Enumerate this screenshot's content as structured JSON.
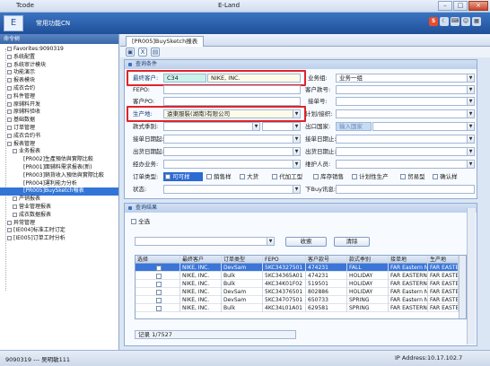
{
  "window": {
    "tcode_label": "Tcode",
    "app_title": "E-Land"
  },
  "header": {
    "app_name": "常用功能CN",
    "logo_glyph": "S"
  },
  "sidebar": {
    "title": "命令树",
    "nodes": [
      {
        "label": "Favorites:9090319",
        "level": 1
      },
      {
        "label": "系统配置",
        "level": 1
      },
      {
        "label": "系统审计模块",
        "level": 1
      },
      {
        "label": "功能演示",
        "level": 1
      },
      {
        "label": "报表模块",
        "level": 1
      },
      {
        "label": "成衣合约",
        "level": 1
      },
      {
        "label": "料件管理",
        "level": 1
      },
      {
        "label": "原辅料开发",
        "level": 1
      },
      {
        "label": "原辅料验收",
        "level": 1
      },
      {
        "label": "基础数据",
        "level": 1
      },
      {
        "label": "订单管理",
        "level": 1
      },
      {
        "label": "成衣合约书",
        "level": 1
      },
      {
        "label": "报表管理",
        "level": 1
      },
      {
        "label": "业务报表",
        "level": 2
      },
      {
        "label": "[PR002]生產預估與實際比較",
        "level": 3
      },
      {
        "label": "[PR001]面辅料需求报表(新)",
        "level": 3
      },
      {
        "label": "[PR003]銷貨收入預估與實際比較",
        "level": 3
      },
      {
        "label": "[PR004]運利能力分析",
        "level": 3
      },
      {
        "label": "[PR005]BuySketch報表",
        "level": 3,
        "selected": true
      },
      {
        "label": "产销报表",
        "level": 2
      },
      {
        "label": "营业管理报表",
        "level": 2
      },
      {
        "label": "成衣数据报表",
        "level": 2
      },
      {
        "label": "异常管理",
        "level": 1
      },
      {
        "label": "[IE004]标准工时订定",
        "level": 1
      },
      {
        "label": "[IE005]订单工时分析",
        "level": 1
      }
    ]
  },
  "tab": {
    "label": "[PR005]BuySketch报表"
  },
  "query_panel": {
    "title": "查询条件",
    "final_customer_label": "最终客户:",
    "final_customer_code": "C34",
    "final_customer_name": "NIKE, INC.",
    "business_group_label": "业务组:",
    "business_group_value": "业务一组",
    "fepo_label": "FEPO:",
    "customer_style_label": "客户款号:",
    "customer_po_label": "客户PO:",
    "order_no_label": "接单号:",
    "production_site_label": "生产地:",
    "production_site_value": "遠東服裝(湖南)有限公司",
    "plan_line_label": "计划/接织:",
    "season_label": "款式季别:",
    "export_country_label": "出口国家:",
    "export_country_placeholder": "输入国家",
    "order_date_label": "接单日期起:",
    "order_date_to_label": "接单日期止:",
    "ship_date_label": "出货日期起:",
    "ship_date_to_label": "出货日期止:",
    "dealer_label": "经办业务:",
    "maintainer_label": "维护人员:",
    "order_type_label": "订单类型:",
    "order_types": [
      "可可样",
      "銷售样",
      "大货",
      "代加工型",
      "库存销售",
      "计划性生产",
      "贸易型",
      "确认样"
    ],
    "status_label": "状态:",
    "buy_status_label": "下Buy讯息:"
  },
  "result_panel": {
    "title": "查询结果",
    "select_all_label": "全选",
    "query_button": "收索",
    "clear_button": "清除",
    "columns": [
      "选择",
      "最终客户",
      "订单类型",
      "FEPO",
      "客户款号",
      "款式季别",
      "接单地",
      "生产地"
    ],
    "rows": [
      [
        "",
        "NIKE, INC.",
        "DevSam",
        "5KC34327501",
        "474231",
        "FALL",
        "FAR Eastern N...",
        "FAR EASTERN..."
      ],
      [
        "",
        "NIKE, INC.",
        "Bulk",
        "5KC34365A01",
        "474231",
        "HOLIDAY",
        "FAR EASTERN...",
        "FAR EASTERN..."
      ],
      [
        "",
        "NIKE, INC.",
        "Bulk",
        "4KC34K01F02",
        "519501",
        "HOLIDAY",
        "FAR EASTERN...",
        "FAR EASTERN..."
      ],
      [
        "",
        "NIKE, INC.",
        "DevSam",
        "5KC34376501",
        "802886",
        "HOLIDAY",
        "FAR Eastern N...",
        "FAR EASTERN..."
      ],
      [
        "",
        "NIKE, INC.",
        "DevSam",
        "5KC34707501",
        "650733",
        "SPRING",
        "FAR Eastern N...",
        "FAR EASTERN..."
      ],
      [
        "",
        "NIKE, INC.",
        "Bulk",
        "4KC34L01A01",
        "629581",
        "SPRING",
        "FAR EASTERN...",
        "FAR EASTERN..."
      ]
    ],
    "record_info": "记录 1/7527"
  },
  "status": {
    "user": "9090319 --- 吴明敏111",
    "ip": "IP Address:10.17.102.7"
  },
  "colors": {
    "accent": "#3375d7",
    "header": "#2a5da8",
    "highlight": "#e0242a"
  }
}
